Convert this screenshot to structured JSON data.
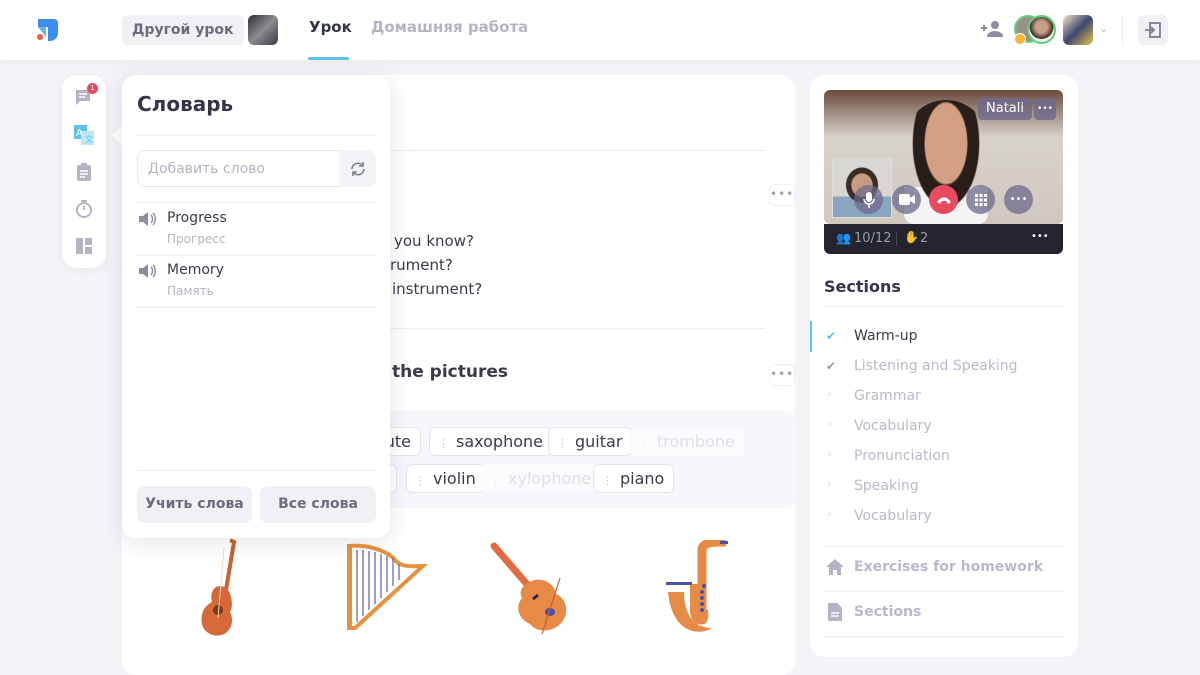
{
  "header": {
    "other_lesson": "Другой урок",
    "tabs": [
      {
        "label": "Урок",
        "active": true
      },
      {
        "label": "Домашняя работа",
        "active": false
      }
    ],
    "accent": "#5ec3ea"
  },
  "rail": {
    "chat_badge": "1",
    "icons": [
      "chat-icon",
      "translate-icon",
      "clipboard-icon",
      "stopwatch-icon",
      "layout-icon"
    ]
  },
  "dictionary": {
    "title": "Словарь",
    "input_placeholder": "Добавить слово",
    "input_value": "",
    "words": [
      {
        "en": "Progress",
        "ru": "Прогресс"
      },
      {
        "en": "Memory",
        "ru": "Память"
      }
    ],
    "learn_button": "Учить слова",
    "all_button": "Все слова"
  },
  "lesson": {
    "question_fragments": [
      "you know?",
      "rument?",
      "instrument?"
    ],
    "heading_fragment": "the pictures",
    "more": "•••",
    "chips_row1": [
      {
        "text": "ute",
        "used": false
      },
      {
        "text": "saxophone",
        "used": false
      },
      {
        "text": "guitar",
        "used": false
      },
      {
        "text": "trombone",
        "used": true
      }
    ],
    "chips_row2": [
      {
        "text": "violin",
        "used": false
      },
      {
        "text": "xylophone",
        "used": true
      },
      {
        "text": "piano",
        "used": false
      }
    ],
    "pictures": [
      "guitar",
      "harp",
      "violin",
      "saxophone"
    ]
  },
  "video": {
    "name": "Natali",
    "participants": "10/12",
    "hands": "2",
    "more": "•••",
    "end_call_color": "#e84a5f"
  },
  "sections": {
    "title": "Sections",
    "items": [
      {
        "label": "Warm-up",
        "state": "current"
      },
      {
        "label": "Listening and Speaking",
        "state": "done"
      },
      {
        "label": "Grammar",
        "state": "pending"
      },
      {
        "label": "Vocabulary",
        "state": "pending"
      },
      {
        "label": "Pronunciation",
        "state": "pending"
      },
      {
        "label": "Speaking",
        "state": "pending"
      },
      {
        "label": "Vocabulary",
        "state": "pending"
      }
    ],
    "homework": "Exercises for homework",
    "sections_link": "Sections"
  }
}
